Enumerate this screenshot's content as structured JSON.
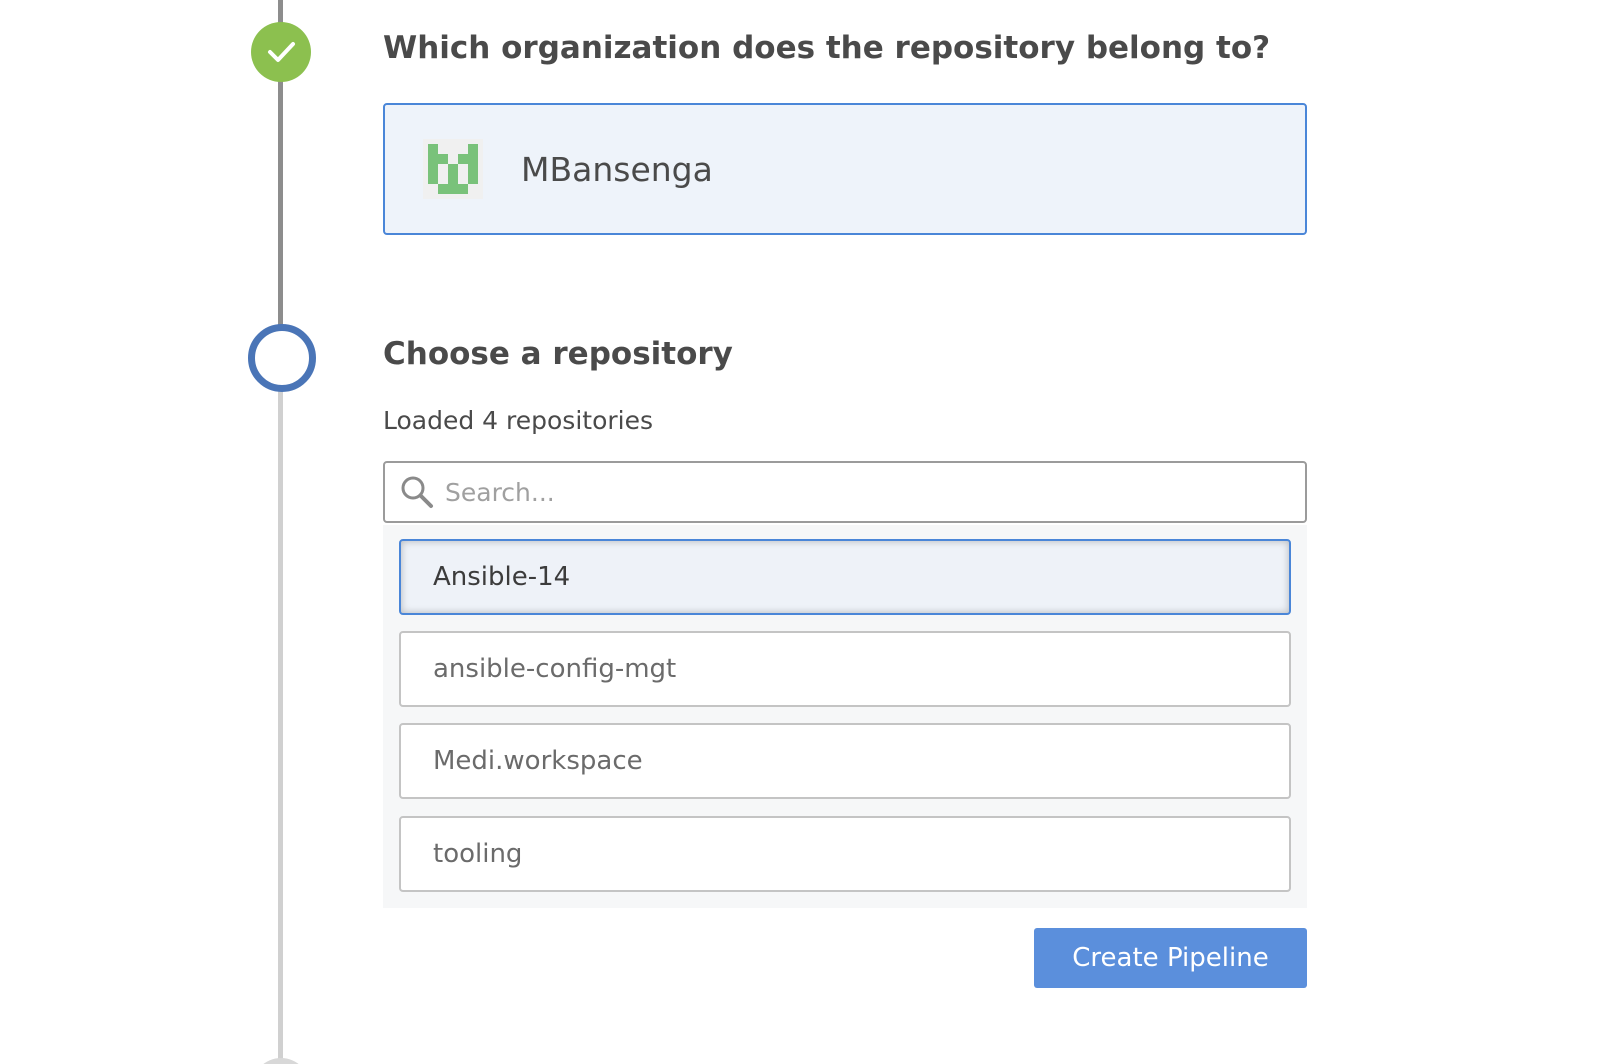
{
  "steps": [
    {
      "id": "organization",
      "status": "complete",
      "icon": "check-icon",
      "status_color": "#8cc04f",
      "heading": "Which organization does the repository belong to?",
      "selected_org": {
        "name": "MBansenga",
        "avatar_icon": "identicon",
        "avatar_color": "#79c27a"
      }
    },
    {
      "id": "repository",
      "status": "current",
      "status_color": "#4a75b7",
      "heading": "Choose a repository",
      "loaded_text": "Loaded 4 repositories",
      "search": {
        "placeholder": "Search...",
        "value": "",
        "icon": "search-icon"
      },
      "repositories": [
        {
          "name": "Ansible-14",
          "selected": true
        },
        {
          "name": "ansible-config-mgt",
          "selected": false
        },
        {
          "name": "Medi.workspace",
          "selected": false
        },
        {
          "name": "tooling",
          "selected": false
        }
      ],
      "create_button_label": "Create Pipeline"
    },
    {
      "id": "next",
      "status": "pending"
    }
  ],
  "colors": {
    "accent": "#4a86d8",
    "button": "#5b8fdc",
    "success": "#8cc04f"
  }
}
